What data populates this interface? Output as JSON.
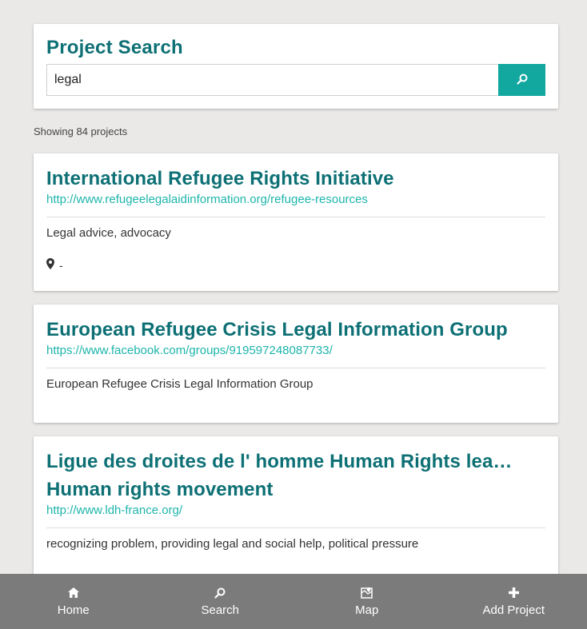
{
  "search": {
    "title": "Project Search",
    "value": "legal",
    "button_icon": "search-icon"
  },
  "results": {
    "count_text": "Showing 84 projects"
  },
  "projects": [
    {
      "title": "International Refugee Rights Initiative",
      "url": "http://www.refugeelegalaidinformation.org/refugee-resources",
      "description": "Legal advice, advocacy",
      "location": "-"
    },
    {
      "title": "European Refugee Crisis Legal Information Group",
      "url": "https://www.facebook.com/groups/919597248087733/",
      "description": "European Refugee Crisis Legal Information Group"
    },
    {
      "title": "Ligue des droites de l' homme Human Rights lea… Human rights movement",
      "url": "http://www.ldh-france.org/",
      "description": "recognizing problem, providing legal and social help, political pressure"
    }
  ],
  "nav": {
    "items": [
      {
        "label": "Home",
        "icon": "home-icon"
      },
      {
        "label": "Search",
        "icon": "search-icon"
      },
      {
        "label": "Map",
        "icon": "map-icon"
      },
      {
        "label": "Add Project",
        "icon": "plus-icon"
      }
    ]
  },
  "colors": {
    "accent": "#12a8a0",
    "title": "#0d7075",
    "link": "#1eb5ac",
    "nav_bg": "#7b7b7b",
    "page_bg": "#ebe9e8"
  }
}
